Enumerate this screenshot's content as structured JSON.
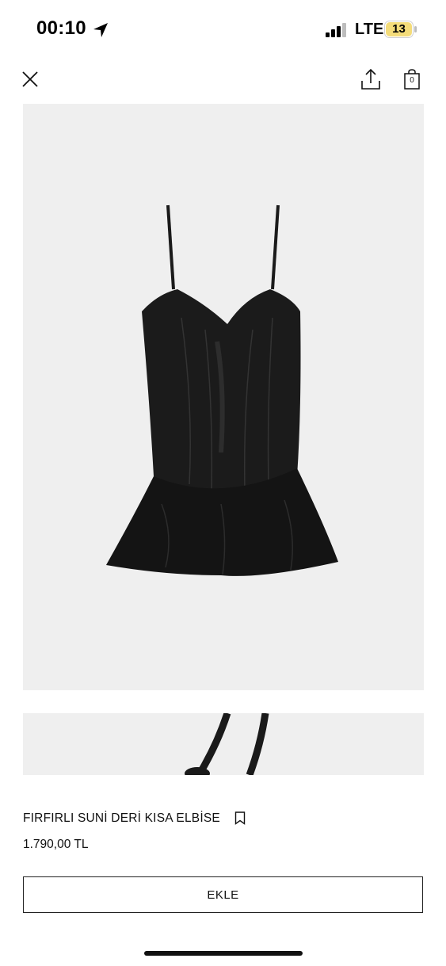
{
  "status_bar": {
    "time": "00:10",
    "network": "LTE",
    "battery": "13",
    "battery_color": "#f4dc7a"
  },
  "header": {
    "close_icon": "close-icon",
    "share_icon": "share-icon",
    "bag_icon": "shopping-bag-icon",
    "bag_count": "0"
  },
  "product": {
    "name": "FIRFIRLI SUNİ DERİ KISA ELBİSE",
    "price": "1.790,00 TL",
    "add_button": "EKLE",
    "image_bg": "#efefef"
  }
}
